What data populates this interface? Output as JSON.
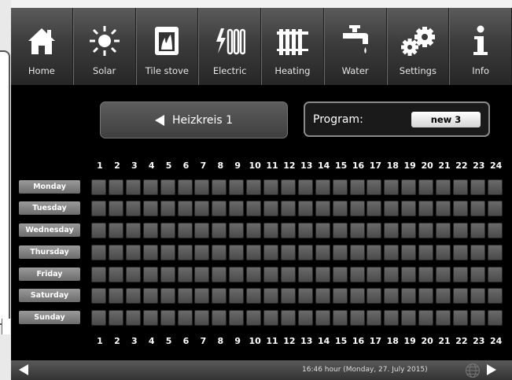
{
  "nav": [
    {
      "label": "Home",
      "icon": "home-icon"
    },
    {
      "label": "Solar",
      "icon": "sun-icon"
    },
    {
      "label": "Tile stove",
      "icon": "tile-stove-icon"
    },
    {
      "label": "Electric",
      "icon": "electric-heater-icon"
    },
    {
      "label": "Heating",
      "icon": "radiator-icon"
    },
    {
      "label": "Water",
      "icon": "water-tap-icon"
    },
    {
      "label": "Settings",
      "icon": "gears-icon"
    },
    {
      "label": "Info",
      "icon": "info-icon"
    }
  ],
  "circuit": {
    "label": "Heizkreis 1"
  },
  "program": {
    "label": "Program:",
    "value": "new 3"
  },
  "hours": [
    "1",
    "2",
    "3",
    "4",
    "5",
    "6",
    "7",
    "8",
    "9",
    "10",
    "11",
    "12",
    "13",
    "14",
    "15",
    "16",
    "17",
    "18",
    "19",
    "20",
    "21",
    "22",
    "23",
    "24"
  ],
  "days": [
    "Monday",
    "Tuesday",
    "Wednesday",
    "Thursday",
    "Friday",
    "Saturday",
    "Sunday"
  ],
  "status": {
    "datetime": "16:46 hour (Monday, 27. July 2015)"
  }
}
